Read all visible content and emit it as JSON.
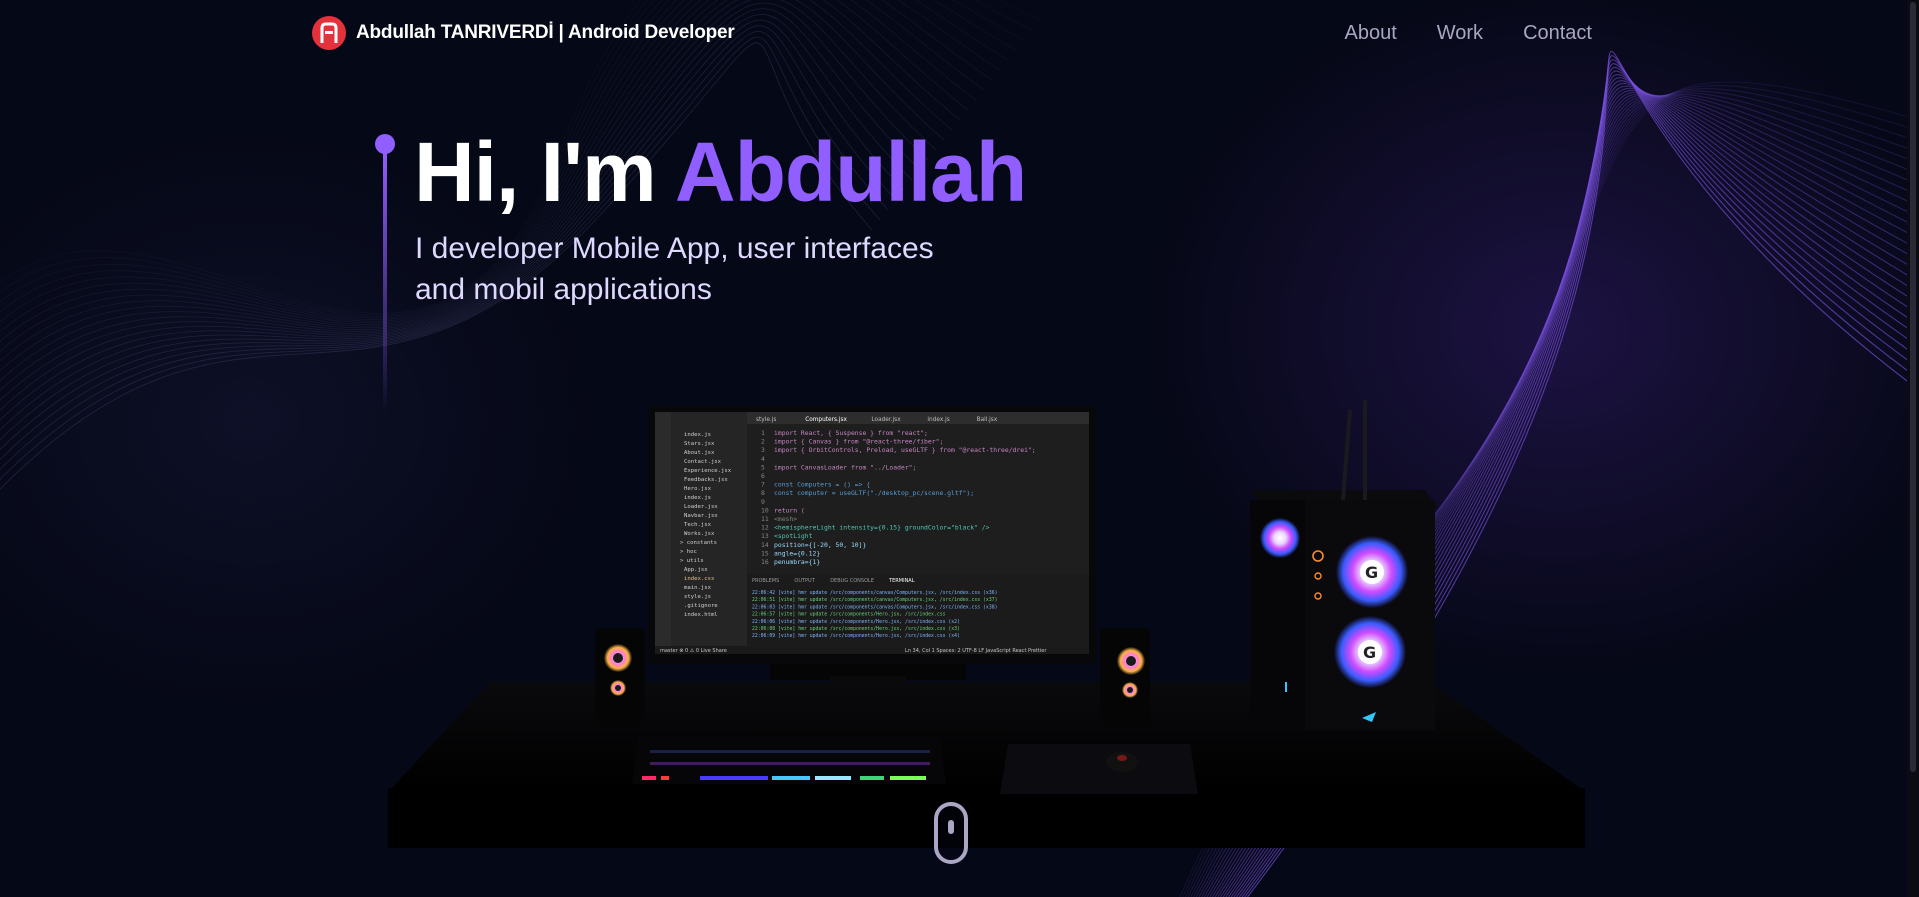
{
  "nav": {
    "logo_text": "Abdullah TANRIVERDİ  | Android Developer",
    "links": [
      {
        "label": "About"
      },
      {
        "label": "Work"
      },
      {
        "label": "Contact"
      }
    ]
  },
  "hero": {
    "greeting": "Hi, I'm ",
    "name": "Abdullah",
    "subtitle": "I developer Mobile App, user interfaces and mobil applications"
  },
  "editor": {
    "tabs": [
      "style.js",
      "Computers.jsx",
      "Loader.jsx",
      "index.js",
      "Ball.jsx"
    ],
    "files": [
      "index.js",
      "Stars.jsx",
      "About.jsx",
      "Contact.jsx",
      "Experience.jsx",
      "Feedbacks.jsx",
      "Hero.jsx",
      "index.js",
      "Loader.jsx",
      "Navbar.jsx",
      "Tech.jsx",
      "Works.jsx",
      "constants",
      "hoc",
      "utils",
      "App.jsx",
      "index.css",
      "main.jsx",
      "style.js",
      ".gitignore",
      "index.html"
    ],
    "code_lines": [
      "import React, { Suspense } from \"react\";",
      "import { Canvas } from \"@react-three/fiber\";",
      "import { OrbitControls, Preload, useGLTF } from \"@react-three/drei\";",
      "",
      "import CanvasLoader from \"../Loader\";",
      "",
      "const Computers = () => {",
      "  const computer = useGLTF(\"./desktop_pc/scene.gltf\");",
      "",
      "  return (",
      "    <mesh>",
      "      <hemisphereLight intensity={0.15} groundColor=\"black\" />",
      "      <spotLight",
      "        position={[-20, 50, 10]}",
      "        angle={0.12}",
      "        penumbra={1}"
    ],
    "terminal_tabs": [
      "PROBLEMS",
      "OUTPUT",
      "DEBUG CONSOLE",
      "TERMINAL"
    ],
    "terminal_lines": [
      "22:06:42 [vite] hmr update /src/components/canvas/Computers.jsx, /src/index.css (x36)",
      "22:06:51 [vite] hmr update /src/components/canvas/Computers.jsx, /src/index.css (x37)",
      "22:06:03 [vite] hmr update /src/components/canvas/Computers.jsx, /src/index.css (x38)",
      "22:06:57 [vite] hmr update /src/components/Hero.jsx, /src/index.css",
      "22:06:06 [vite] hmr update /src/components/Hero.jsx, /src/index.css (x2)",
      "22:06:08 [vite] hmr update /src/components/Hero.jsx, /src/index.css (x3)",
      "22:06:09 [vite] hmr update /src/components/Hero.jsx, /src/index.css (x4)"
    ],
    "status_left": "master  ⊗ 0 ⚠ 0  Live Share",
    "status_right": "Ln 34, Col 1  Spaces: 2  UTF-8  LF  JavaScript React  Prettier"
  },
  "colors": {
    "background": "#050816",
    "accent": "#915eff",
    "logo_red": "#e5313c",
    "nav_text": "#aaa6c3"
  }
}
